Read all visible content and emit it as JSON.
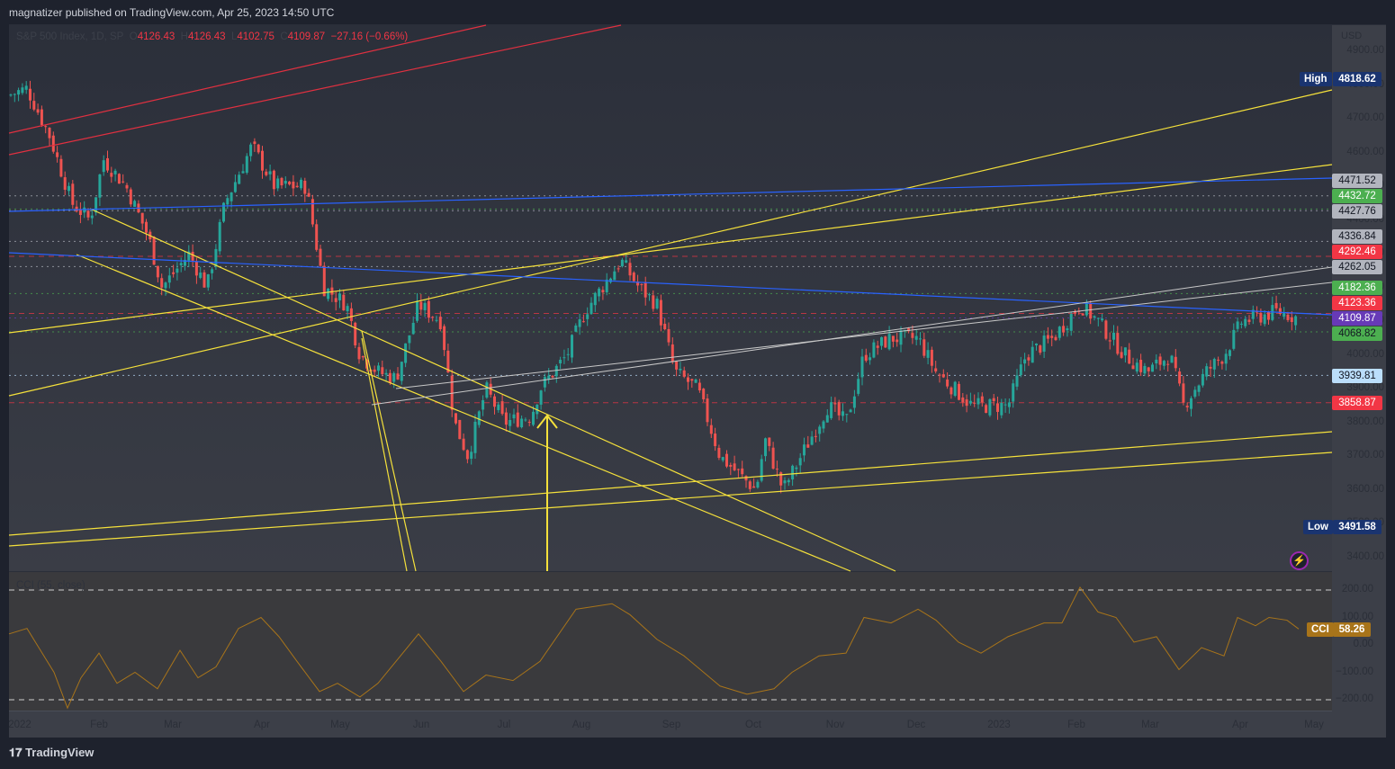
{
  "header": {
    "published": "magnatizer published on TradingView.com, Apr 25, 2023 14:50 UTC"
  },
  "legend": {
    "symbol": "S&P 500 Index, 1D, SP",
    "o_label": "O",
    "open": "4126.43",
    "h_label": "H",
    "high": "4126.43",
    "l_label": "L",
    "low": "4102.75",
    "c_label": "C",
    "close": "4109.87",
    "change": "−27.16 (−0.66%)"
  },
  "price_axis": {
    "currency": "USD",
    "ticks": [
      "4900.00",
      "4800.00",
      "4700.00",
      "4600.00",
      "4500.00",
      "4400.00",
      "4300.00",
      "4200.00",
      "4100.00",
      "4000.00",
      "3900.00",
      "3800.00",
      "3700.00",
      "3600.00",
      "3500.00",
      "3400.00"
    ]
  },
  "levels": [
    {
      "value": "4471.52",
      "bg": "#b2b5be",
      "fg": "#131722"
    },
    {
      "value": "4432.72",
      "bg": "#4caf50",
      "fg": "#ffffff"
    },
    {
      "value": "4427.76",
      "bg": "#b2b5be",
      "fg": "#131722"
    },
    {
      "value": "4336.84",
      "bg": "#b2b5be",
      "fg": "#131722"
    },
    {
      "value": "4292.46",
      "bg": "#f23645",
      "fg": "#ffffff"
    },
    {
      "value": "4262.05",
      "bg": "#b2b5be",
      "fg": "#131722"
    },
    {
      "value": "4182.36",
      "bg": "#4caf50",
      "fg": "#ffffff"
    },
    {
      "value": "4123.36",
      "bg": "#f23645",
      "fg": "#ffffff"
    },
    {
      "value": "4109.87",
      "bg": "#673ab7",
      "fg": "#ffffff"
    },
    {
      "value": "4068.82",
      "bg": "#4caf50",
      "fg": "#131722"
    },
    {
      "value": "3939.81",
      "bg": "#bbdefb",
      "fg": "#131722"
    },
    {
      "value": "3858.87",
      "bg": "#f23645",
      "fg": "#ffffff"
    }
  ],
  "high_marker": {
    "label": "High",
    "value": "4818.62"
  },
  "low_marker": {
    "label": "Low",
    "value": "3491.58"
  },
  "indicator": {
    "title": "CCI (55, close)",
    "label": "CCI",
    "value": "58.26",
    "ticks": [
      "200.00",
      "100.00",
      "0.00",
      "−100.00",
      "−200.00"
    ],
    "color": "#a8741a"
  },
  "time_axis": [
    "2022",
    "Feb",
    "Mar",
    "Apr",
    "May",
    "Jun",
    "Jul",
    "Aug",
    "Sep",
    "Oct",
    "Nov",
    "Dec",
    "2023",
    "Feb",
    "Mar",
    "Apr",
    "May"
  ],
  "colors": {
    "up": "#26a69a",
    "down": "#ef5350",
    "trend": "#f5e13b",
    "red_line": "#e03040",
    "blue_line": "#2962ff"
  },
  "footer": {
    "brand": "TradingView"
  }
}
